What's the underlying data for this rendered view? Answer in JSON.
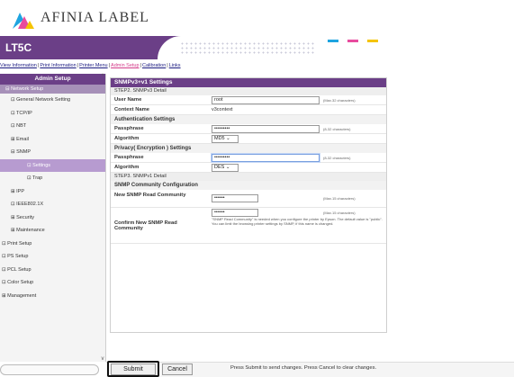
{
  "brand": {
    "logo_text": "AFINIA LABEL",
    "logo_colors": [
      "#1ea4e0",
      "#e84c9e",
      "#f5c400"
    ]
  },
  "header": {
    "model": "LT5C",
    "dash_colors": [
      "#1ea4e0",
      "#e84c9e",
      "#f5c400"
    ]
  },
  "topnav": {
    "items": [
      "View Information",
      "Print Information",
      "Printer Menu",
      "Admin Setup",
      "Calibration",
      "Links"
    ],
    "active_index": 3,
    "separator": "|"
  },
  "sidebar": {
    "title": "Admin Setup",
    "subtitle": "Network Setup",
    "items": [
      "General Network Setting",
      "TCP/IP",
      "NBT",
      "Email",
      "SNMP",
      "Settings",
      "Trap",
      "IPP",
      "IEEE802.1X",
      "Security",
      "Maintenance",
      "Print Setup",
      "PS Setup",
      "PCL Setup",
      "Color Setup",
      "Management"
    ],
    "selected_index": 5
  },
  "panel": {
    "title": "SNMPv3+v1 Settings",
    "step2": "STEP2.  SNMPv3 Detail",
    "user_name_label": "User Name",
    "user_name_value": "root",
    "user_name_hint": "(Max.32 characters)",
    "context_name_label": "Context Name",
    "context_name_value": "v3context",
    "auth_section": "Authentication Settings",
    "passphrase_label": "Passphrase",
    "auth_passphrase_value": "•••••••••",
    "auth_passphrase_hint": "(8-32 characters)",
    "algorithm_label": "Algorithm",
    "auth_algorithm_value": "MD5",
    "privacy_section": "Privacy( Encryption ) Settings",
    "priv_passphrase_value": "•••••••••",
    "priv_passphrase_hint": "(8-32 characters)",
    "priv_algorithm_value": "DES",
    "step3": "STEP3.  SNMPv1 Detail",
    "community_section": "SNMP Community Configuration",
    "read_community_label": "New SNMP Read Community",
    "read_community_value": "••••••",
    "read_community_hint": "(Max.15 characters)",
    "confirm_label": "Confirm New SNMP Read Community",
    "confirm_value": "••••••",
    "confirm_hint": "(Max.15 characters)",
    "note": "\"SNMP Read Community\" is needed when you configure the printer by Epson. The default value is \"public\". You can limit the browsing printer settings by SNMP, if this name is changed."
  },
  "footer": {
    "submit_label": "Submit",
    "cancel_label": "Cancel",
    "message": "Press Submit to send changes. Press Cancel to clear changes."
  }
}
